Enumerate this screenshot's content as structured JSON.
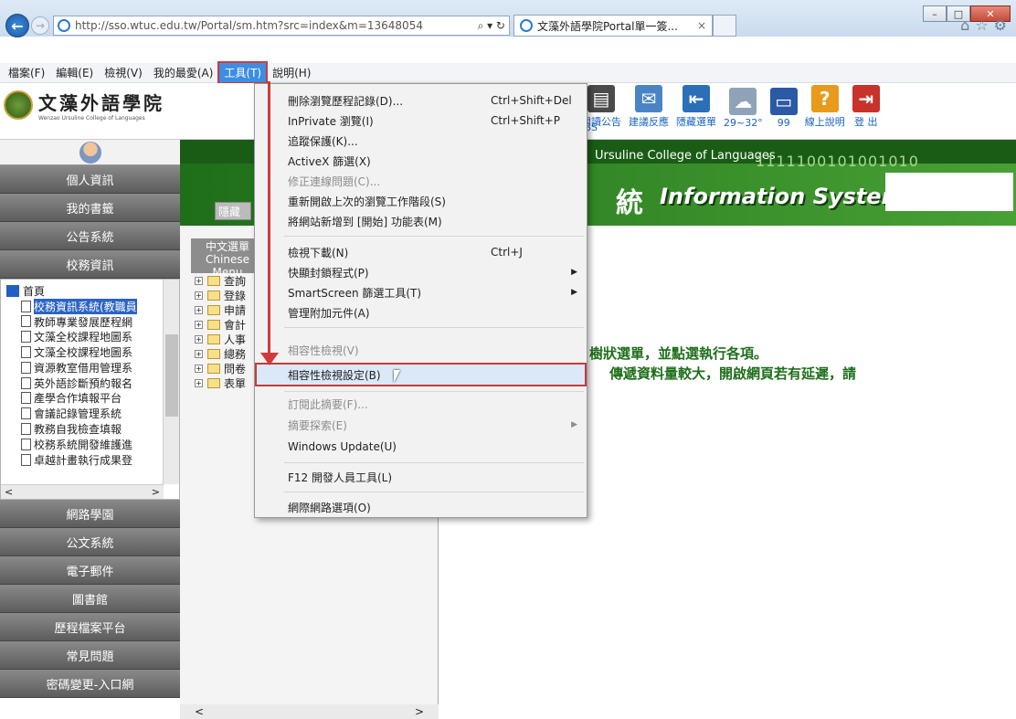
{
  "browser": {
    "url": "http://sso.wtuc.edu.tw/Portal/sm.htm?src=index&m=13648054",
    "address_controls": "⌕ ▾ ↻",
    "tab_title": "文藻外語學院Portal單一簽...",
    "tab_close": "×",
    "window_controls": [
      "–",
      "□",
      "✕"
    ],
    "right_icons": [
      "⌂",
      "☆",
      "⚙"
    ]
  },
  "menubar": [
    "檔案(F)",
    "編輯(E)",
    "檢視(V)",
    "我的最愛(A)",
    "工具(T)",
    "說明(H)"
  ],
  "logo": {
    "cn": "文藻外語學院",
    "en": "Wenzao Ursuline College of Languages"
  },
  "toolbar_icons": [
    {
      "label": "閱讀公告",
      "icon": "notice-icon",
      "color": "#4a4a4a"
    },
    {
      "label": "建議反應",
      "icon": "feedback-icon",
      "color": "#4a84c4"
    },
    {
      "label": "隱藏選單",
      "icon": "hide-menu-icon",
      "color": "#2a6fb8"
    },
    {
      "label": "29~32°",
      "icon": "weather-icon",
      "color": "#8fa3b8"
    },
    {
      "label": "99",
      "icon": "monitor-icon",
      "color": "#2a5aa6"
    },
    {
      "label": "線上說明",
      "icon": "help-book-icon",
      "color": "#e89a1c"
    },
    {
      "label": "登 出",
      "icon": "logout-icon",
      "color": "#c8322a"
    }
  ],
  "toolbar_partial_label": "SS",
  "sidebar": {
    "top_buttons": [
      "個人資訊",
      "我的書籤",
      "公告系統",
      "校務資訊"
    ],
    "tree_root": "首頁",
    "tree_items": [
      "校務資訊系統(教職員",
      "教師專業發展歷程網",
      "文藻全校課程地圖系",
      "文藻全校課程地圖系",
      "資源教室借用管理系",
      "英外語診斷預約報名",
      "產學合作填報平台",
      "會議記錄管理系統",
      "教務自我檢查填報",
      "校務系統開發維護進",
      "卓越計畫執行成果登"
    ],
    "bottom_buttons": [
      "網路學園",
      "公文系統",
      "電子郵件",
      "圖書館",
      "歷程檔案平台",
      "常見問題",
      "密碼變更-入口網"
    ]
  },
  "hero": {
    "en": "Ursuline College of Languages",
    "binary": "1111100101001010",
    "cn": "統",
    "info": "Information System",
    "hide_btn": "隱藏"
  },
  "midpanel": {
    "header": "中文選單 Chinese Menu",
    "folders": [
      "查詢",
      "登錄",
      "申請",
      "會計",
      "人事",
      "總務",
      "問卷",
      "表單"
    ]
  },
  "notice": {
    "line1": "樹狀選單，並點選執行各項。",
    "line2": "傳遞資料量較大，開啟網頁若有延遲，請"
  },
  "dropdown": [
    {
      "label": "刪除瀏覽歷程記錄(D)...",
      "shortcut": "Ctrl+Shift+Del"
    },
    {
      "label": "InPrivate 瀏覽(I)",
      "shortcut": "Ctrl+Shift+P"
    },
    {
      "label": "追蹤保護(K)..."
    },
    {
      "label": "ActiveX 篩選(X)"
    },
    {
      "label": "修正連線問題(C)...",
      "disabled": true
    },
    {
      "label": "重新開啟上次的瀏覽工作階段(S)"
    },
    {
      "label": "將網站新增到 [開始] 功能表(M)"
    },
    {
      "label": "檢視下載(N)",
      "shortcut": "Ctrl+J"
    },
    {
      "label": "快顯封鎖程式(P)",
      "arrow": "▶"
    },
    {
      "label": "SmartScreen 篩選工具(T)",
      "arrow": "▶"
    },
    {
      "label": "管理附加元件(A)"
    },
    {
      "label": "相容性檢視(V)",
      "disabled": true
    },
    {
      "label": "相容性檢視設定(B)",
      "highlight": true
    },
    {
      "label": "訂閱此摘要(F)...",
      "disabled": true
    },
    {
      "label": "摘要探索(E)",
      "disabled": true,
      "arrow": "▶"
    },
    {
      "label": "Windows Update(U)"
    },
    {
      "label": "F12 開發人員工具(L)"
    },
    {
      "label": "網際網路選項(O)"
    }
  ]
}
